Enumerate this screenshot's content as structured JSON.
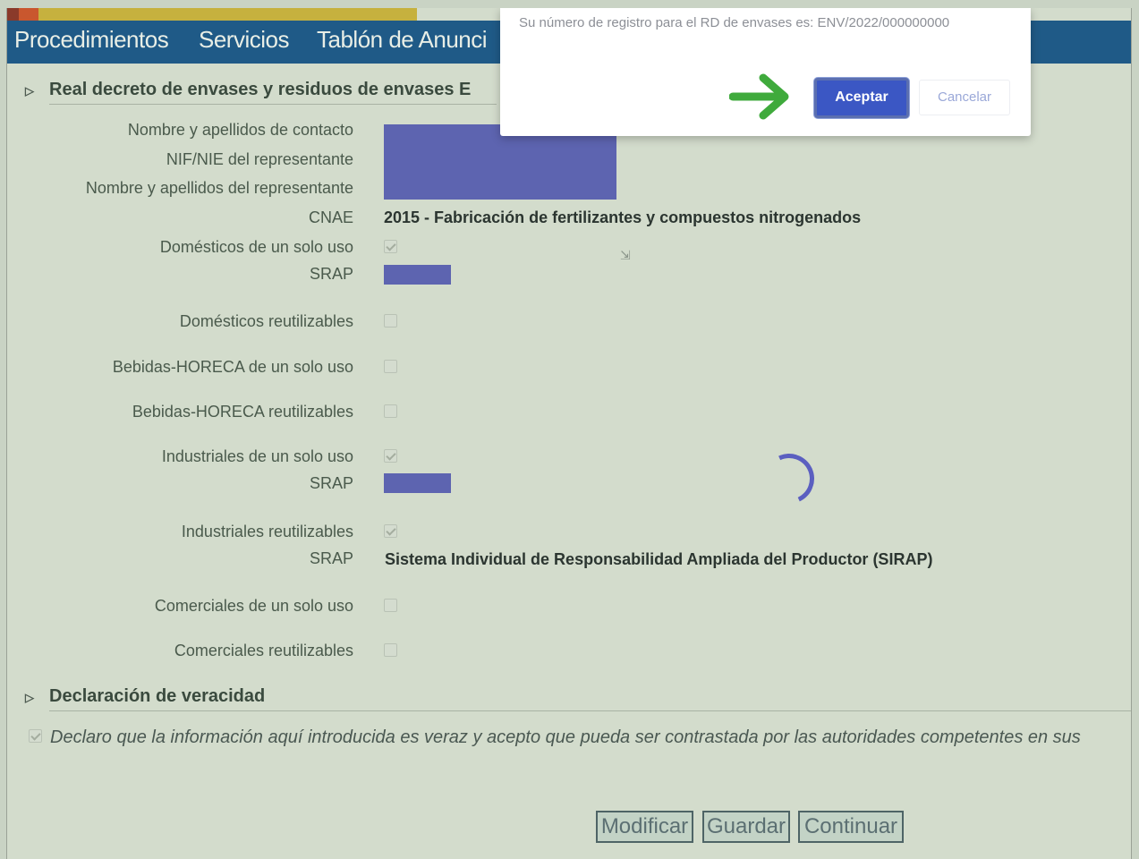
{
  "nav": {
    "items": [
      "Procedimientos",
      "Servicios",
      "Tablón de Anunci"
    ]
  },
  "section_envases": {
    "title": "Real decreto de envases y residuos de envases E"
  },
  "form": {
    "contact_name_label": "Nombre y apellidos de contacto",
    "nif_label": "NIF/NIE del representante",
    "rep_name_label": "Nombre y apellidos del representante",
    "cnae_label": "CNAE",
    "cnae_value": "2015 - Fabricación de fertilizantes y compuestos nitrogenados",
    "domesticos_unico_label": "Domésticos de un solo uso",
    "domesticos_unico_checked": true,
    "srap_label": "SRAP",
    "domesticos_reut_label": "Domésticos reutilizables",
    "domesticos_reut_checked": false,
    "bebidas_unico_label": "Bebidas-HORECA de un solo uso",
    "bebidas_unico_checked": false,
    "bebidas_reut_label": "Bebidas-HORECA reutilizables",
    "bebidas_reut_checked": false,
    "industriales_unico_label": "Industriales de un solo uso",
    "industriales_unico_checked": true,
    "industriales_reut_label": "Industriales reutilizables",
    "industriales_reut_checked": true,
    "srap_industriales_reut_value": "Sistema Individual de Responsabilidad Ampliada del Productor (SIRAP)",
    "comerciales_unico_label": "Comerciales de un solo uso",
    "comerciales_unico_checked": false,
    "comerciales_reut_label": "Comerciales reutilizables",
    "comerciales_reut_checked": false
  },
  "section_veracidad": {
    "title": "Declaración de veracidad",
    "declaration_text": "Declaro que la información aquí introducida es veraz y acepto que pueda ser contrastada por las autoridades competentes en sus",
    "declaration_checked": true
  },
  "actions": {
    "modify_label": "Modificar",
    "save_label": "Guardar",
    "continue_label": "Continuar"
  },
  "dialog": {
    "message": "Su número de registro para el RD de envases es: ENV/2022/000000000",
    "accept_label": "Aceptar",
    "cancel_label": "Cancelar"
  },
  "colors": {
    "nav_bg": "#1f5a87",
    "accept_button": "#3b57c4",
    "redaction": "#5d64b0",
    "arrow": "#3faa3c",
    "spinner": "#5b5fc0"
  }
}
